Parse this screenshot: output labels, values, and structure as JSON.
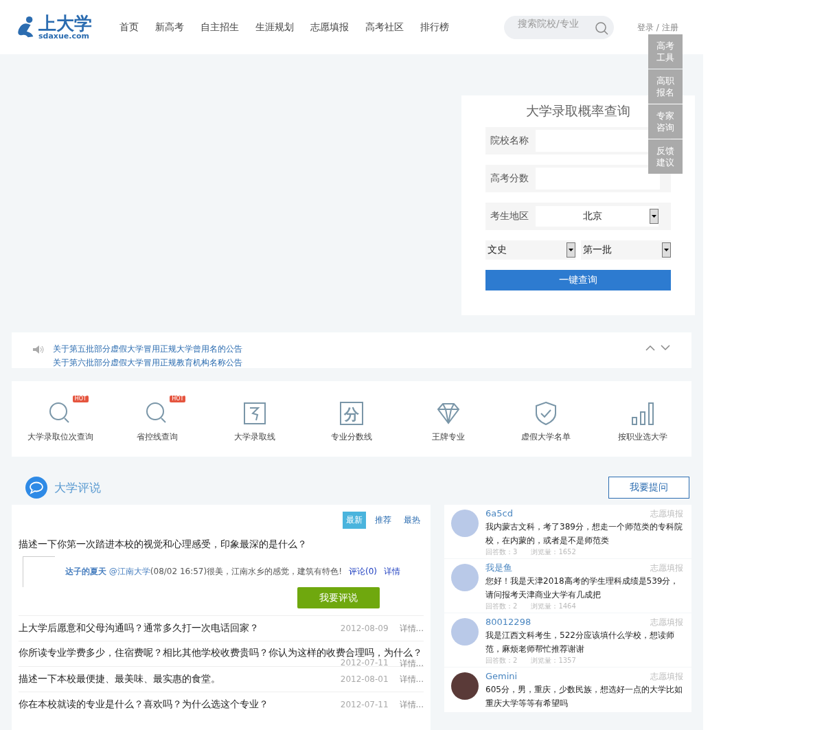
{
  "header": {
    "logo": {
      "text": "上大学",
      "sub": "sdaxue.com"
    },
    "nav": [
      "首页",
      "新高考",
      "自主招生",
      "生涯规划",
      "志愿填报",
      "高考社区",
      "排行榜"
    ],
    "search": {
      "placeholder": "搜索院校/专业"
    },
    "login": "登录 / 注册"
  },
  "side_tools": [
    "高考工具",
    "高职报名",
    "专家咨询",
    "反馈建议"
  ],
  "query_card": {
    "title": "大学录取概率查询",
    "fields": [
      {
        "kind": "text",
        "label": "院校名称"
      },
      {
        "kind": "text",
        "label": "高考分数"
      },
      {
        "kind": "select",
        "label": "考生地区",
        "value": "北京"
      }
    ],
    "selects": [
      "文史",
      "第一批"
    ],
    "button": "一键查询"
  },
  "notices": [
    "关于第五批部分虚假大学冒用正规大学曾用名的公告",
    "关于第六批部分虚假大学冒用正规教育机构名称公告"
  ],
  "tools": [
    {
      "kind": "search",
      "label": "大学录取位次查询",
      "badge": "HOT"
    },
    {
      "kind": "search",
      "label": "省控线查询",
      "badge": "HOT"
    },
    {
      "kind": "line",
      "label": "大学录取线"
    },
    {
      "kind": "score",
      "label": "专业分数线",
      "glyph": "分"
    },
    {
      "kind": "diamond",
      "label": "王牌专业"
    },
    {
      "kind": "shield",
      "label": "虚假大学名单"
    },
    {
      "kind": "bars",
      "label": "按职业选大学"
    }
  ],
  "reviews": {
    "title": "大学评说",
    "ask_button": "我要提问",
    "tabs": [
      {
        "label": "最新",
        "selected": true
      },
      {
        "label": "推荐",
        "selected": false
      },
      {
        "label": "最热",
        "selected": false
      }
    ],
    "featured": {
      "question": "描述一下你第一次踏进本校的视觉和心理感受，印象最深的是什么？",
      "user": "达子的夏天",
      "school": "@江南大学",
      "text": "(08/02 16:57)很美，江南水乡的感觉，建筑有特色!",
      "comments": "评论(0)",
      "detail": "详情",
      "button": "我要评说"
    },
    "rows": [
      {
        "question": "上大学后愿意和父母沟通吗？通常多久打一次电话回家？",
        "date": "2012-08-09",
        "more": "详情..."
      },
      {
        "question": "你所读专业学费多少，住宿费呢？相比其他学校收费贵吗？你认为这样的收费合理吗，为什么？",
        "date": "2012-07-11",
        "more": "详情..."
      },
      {
        "question": "描述一下本校最便捷、最美味、最实惠的食堂。",
        "date": "2012-08-01",
        "more": "详情..."
      },
      {
        "question": "你在本校就读的专业是什么？喜欢吗？为什么选这个专业？",
        "date": "2012-07-11",
        "more": "详情..."
      }
    ]
  },
  "questions": [
    {
      "kind": "cartoon",
      "user": "6a5cd",
      "category": "志愿填报",
      "text": "我内蒙古文科，考了389分，想走一个师范类的专科院校，在内蒙的，或者是不是师范类",
      "answers": "回答数：3",
      "views": "浏览量：1652"
    },
    {
      "kind": "cartoon",
      "user": "我是鱼",
      "category": "志愿填报",
      "text": "您好！我是天津2018高考的学生理科成绩是539分，请问报考天津商业大学有几成把",
      "answers": "回答数：2",
      "views": "浏览量：1464"
    },
    {
      "kind": "cartoon",
      "user": "80012298",
      "category": "志愿填报",
      "text": "我是江西文科考生，522分应该填什么学校，想读师范，麻烦老师帮忙推荐谢谢",
      "answers": "回答数：2",
      "views": "浏览量：1357"
    },
    {
      "kind": "photo",
      "user": "Gemini",
      "category": "志愿填报",
      "text": "605分，男，重庆，少数民族，想选好一点的大学比如重庆大学等等有希望吗"
    }
  ]
}
